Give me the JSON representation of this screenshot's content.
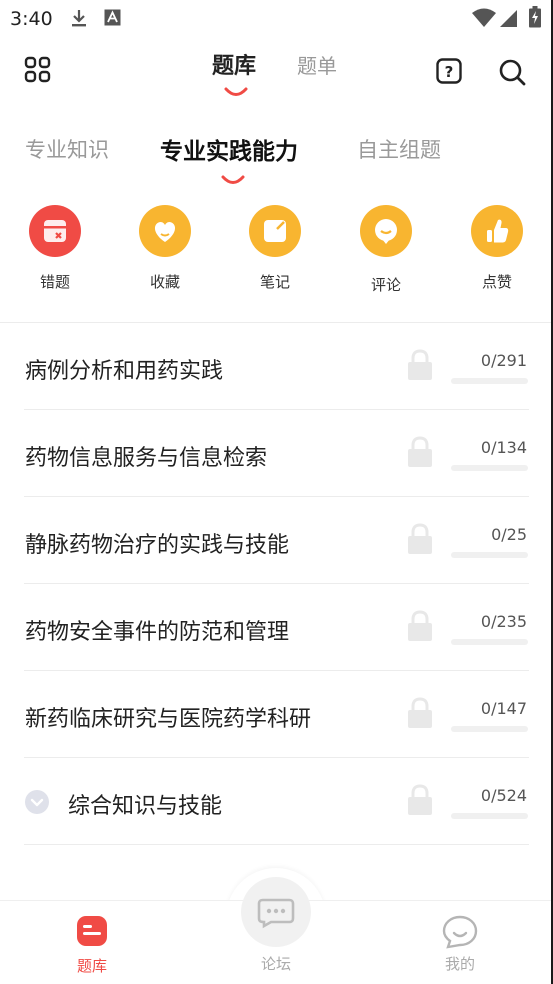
{
  "status_bar": {
    "time": "3:40",
    "icons": [
      "download-icon",
      "a-badge-icon",
      "wifi-icon",
      "signal-icon",
      "battery-icon"
    ]
  },
  "header": {
    "tabs": [
      {
        "label": "题库",
        "active": true
      },
      {
        "label": "题单",
        "active": false
      }
    ],
    "icons": [
      "grid-icon",
      "help-icon",
      "search-icon"
    ]
  },
  "sub_tabs": [
    {
      "label": "专业知识",
      "active": false
    },
    {
      "label": "专业实践能力",
      "active": true
    },
    {
      "label": "自主组题",
      "active": false
    }
  ],
  "quick_actions": [
    {
      "label": "错题",
      "icon": "wrong-question-icon",
      "color": "#f04b45"
    },
    {
      "label": "收藏",
      "icon": "heart-icon",
      "color": "#f8b530"
    },
    {
      "label": "笔记",
      "icon": "note-icon",
      "color": "#f8b530"
    },
    {
      "label": "评论",
      "icon": "comment-icon",
      "color": "#f8b530"
    },
    {
      "label": "点赞",
      "icon": "thumbs-up-icon",
      "color": "#f8b530"
    }
  ],
  "chapters": [
    {
      "title": "病例分析和用药实践",
      "count": "0/291",
      "progress": 0,
      "locked": true
    },
    {
      "title": "药物信息服务与信息检索",
      "count": "0/134",
      "progress": 0,
      "locked": true
    },
    {
      "title": "静脉药物治疗的实践与技能",
      "count": "0/25",
      "progress": 0,
      "locked": true
    },
    {
      "title": "药物安全事件的防范和管理",
      "count": "0/235",
      "progress": 0,
      "locked": true
    },
    {
      "title": "新药临床研究与医院药学科研",
      "count": "0/147",
      "progress": 0,
      "locked": true
    },
    {
      "title": "综合知识与技能",
      "count": "0/524",
      "progress": 0,
      "locked": true,
      "expandable": true
    }
  ],
  "bottom_nav": [
    {
      "label": "题库",
      "icon": "question-bank-icon",
      "active": true
    },
    {
      "label": "论坛",
      "icon": "forum-chat-icon",
      "active": false
    },
    {
      "label": "我的",
      "icon": "profile-icon",
      "active": false
    }
  ],
  "colors": {
    "accent": "#f04b45",
    "warm": "#f8b530",
    "inactive_text": "#999999"
  }
}
